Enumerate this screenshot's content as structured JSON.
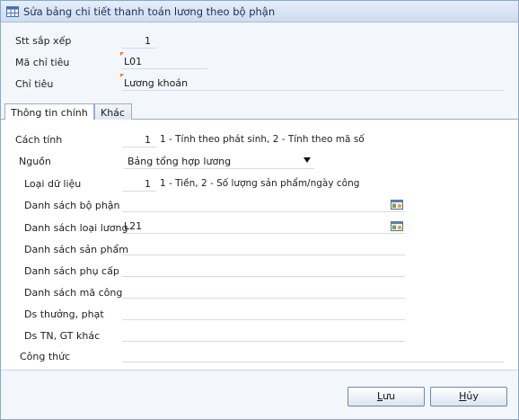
{
  "window": {
    "title": "Sửa bảng chi tiết thanh toán lương theo bộ phận"
  },
  "header": {
    "stt": {
      "label": "Stt sắp xếp",
      "value": "1"
    },
    "ma_chi_tieu": {
      "label": "Mã chỉ tiêu",
      "value": "L01"
    },
    "chi_tieu": {
      "label": "Chỉ tiêu",
      "value": "Lương khoán"
    }
  },
  "tabs": [
    {
      "label": "Thông tin chính",
      "active": true
    },
    {
      "label": "Khác",
      "active": false
    }
  ],
  "main": {
    "cach_tinh": {
      "label": "Cách tính",
      "value": "1",
      "hint": "1 - Tính theo phát sinh, 2 - Tính theo mã số"
    },
    "nguon": {
      "label": "Nguồn",
      "value": "Bảng tổng hợp lương"
    },
    "loai_du_lieu": {
      "label": "Loại dữ liệu",
      "value": "1",
      "hint": "1 - Tiền, 2 - Số lượng sản phẩm/ngày công"
    },
    "ds_bo_phan": {
      "label": "Danh sách bộ phận",
      "value": ""
    },
    "ds_loai_luong": {
      "label": "Danh sách loại lương",
      "value": "L21"
    },
    "ds_san_pham": {
      "label": "Danh sách sản phẩm",
      "value": ""
    },
    "ds_phu_cap": {
      "label": "Danh sách phụ cấp",
      "value": ""
    },
    "ds_ma_cong": {
      "label": "Danh sách mã công",
      "value": ""
    },
    "ds_thuong_phat": {
      "label": "Ds thưởng, phạt",
      "value": ""
    },
    "ds_tn_gt": {
      "label": "Ds TN, GT khác",
      "value": ""
    },
    "cong_thuc": {
      "label": "Công thức",
      "value": ""
    }
  },
  "footer": {
    "save": {
      "first": "L",
      "rest": "ưu"
    },
    "cancel": {
      "first": "H",
      "rest": "ủy"
    }
  },
  "icons": {
    "title": "table-icon",
    "lookup": "lookup-list-icon"
  },
  "colors": {
    "required_marker": "#e8772e",
    "title_text": "#15305a"
  }
}
